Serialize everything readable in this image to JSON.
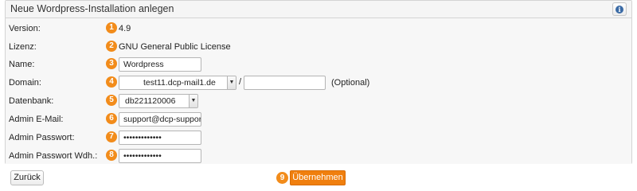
{
  "header": {
    "title": "Neue Wordpress-Installation anlegen",
    "info_icon": "info-icon",
    "info_symbol": "i"
  },
  "form": {
    "version": {
      "label": "Version:",
      "step": "1",
      "value": "4.9"
    },
    "license": {
      "label": "Lizenz:",
      "step": "2",
      "value": "GNU General Public License"
    },
    "name": {
      "label": "Name:",
      "step": "3",
      "value": "Wordpress"
    },
    "domain": {
      "label": "Domain:",
      "step": "4",
      "selected": "test11.dcp-mail1.de",
      "separator": "/",
      "path_value": "",
      "optional_note": "(Optional)"
    },
    "database": {
      "label": "Datenbank:",
      "step": "5",
      "selected": "db221120006"
    },
    "admin_email": {
      "label": "Admin E-Mail:",
      "step": "6",
      "value": "support@dcp-support"
    },
    "admin_password": {
      "label": "Admin Passwort:",
      "step": "7",
      "value": "•••••••••••••"
    },
    "admin_password_repeat": {
      "label": "Admin Passwort Wdh.:",
      "step": "8",
      "value": "•••••••••••••"
    }
  },
  "footer": {
    "back_label": "Zurück",
    "submit_step": "9",
    "submit_label": "Übernehmen"
  },
  "colors": {
    "accent": "#f07f0e",
    "badge": "#f28c1b",
    "info": "#3a6aa5"
  },
  "select_arrow_icon": "▼"
}
